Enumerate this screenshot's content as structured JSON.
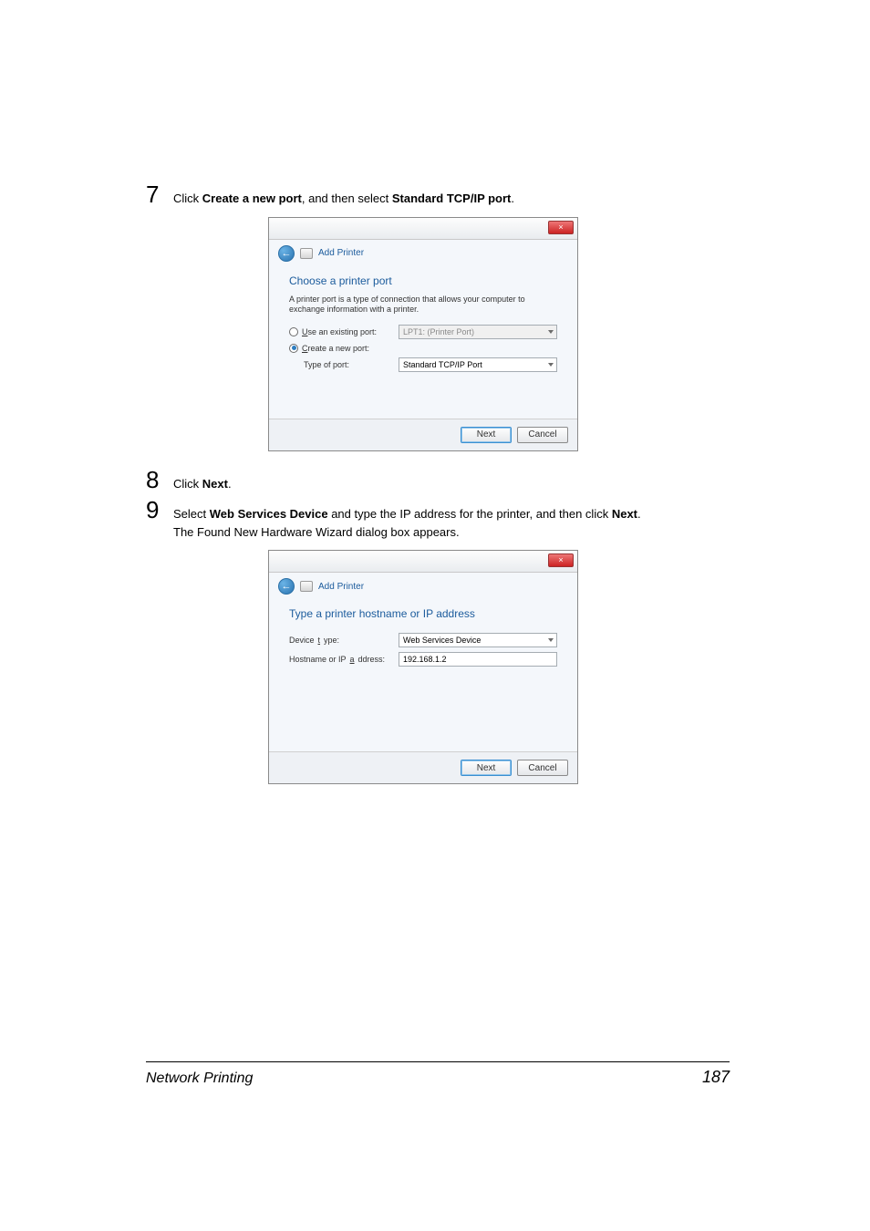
{
  "step7": {
    "num": "7",
    "prefix": "Click ",
    "bold1": "Create a new port",
    "mid": ", and then select ",
    "bold2": "Standard TCP/IP port",
    "suffix": "."
  },
  "step8": {
    "num": "8",
    "prefix": "Click ",
    "bold1": "Next",
    "suffix": "."
  },
  "step9": {
    "num": "9",
    "l1_prefix": "Select ",
    "l1_bold": "Web Services Device",
    "l1_mid": " and type the IP address for the printer, and then click ",
    "l1_bold2": "Next",
    "l1_suffix": ".",
    "l2": "The Found New Hardware Wizard dialog box appears."
  },
  "dlg1": {
    "crumb": "Add Printer",
    "close": "×",
    "title": "Choose a printer port",
    "desc": "A printer port is a type of connection that allows your computer to exchange information with a printer.",
    "opt1_u": "U",
    "opt1_rest": "se an existing port:",
    "opt1_value": "LPT1: (Printer Port)",
    "opt2_u": "C",
    "opt2_rest": "reate a new port:",
    "type_label": "Type of port:",
    "type_value": "Standard TCP/IP Port",
    "btn_next": "Next",
    "btn_cancel": "Cancel"
  },
  "dlg2": {
    "crumb": "Add Printer",
    "close": "×",
    "title": "Type a printer hostname or IP address",
    "dev_u": "t",
    "dev_label_pre": "Device ",
    "dev_label_post": "ype:",
    "dev_value": "Web Services Device",
    "host_label_pre": "Hostname or IP ",
    "host_u": "a",
    "host_label_post": "ddress:",
    "host_value": "192.168.1.2",
    "btn_next": "Next",
    "btn_cancel": "Cancel"
  },
  "footer": {
    "title": "Network Printing",
    "page": "187"
  }
}
